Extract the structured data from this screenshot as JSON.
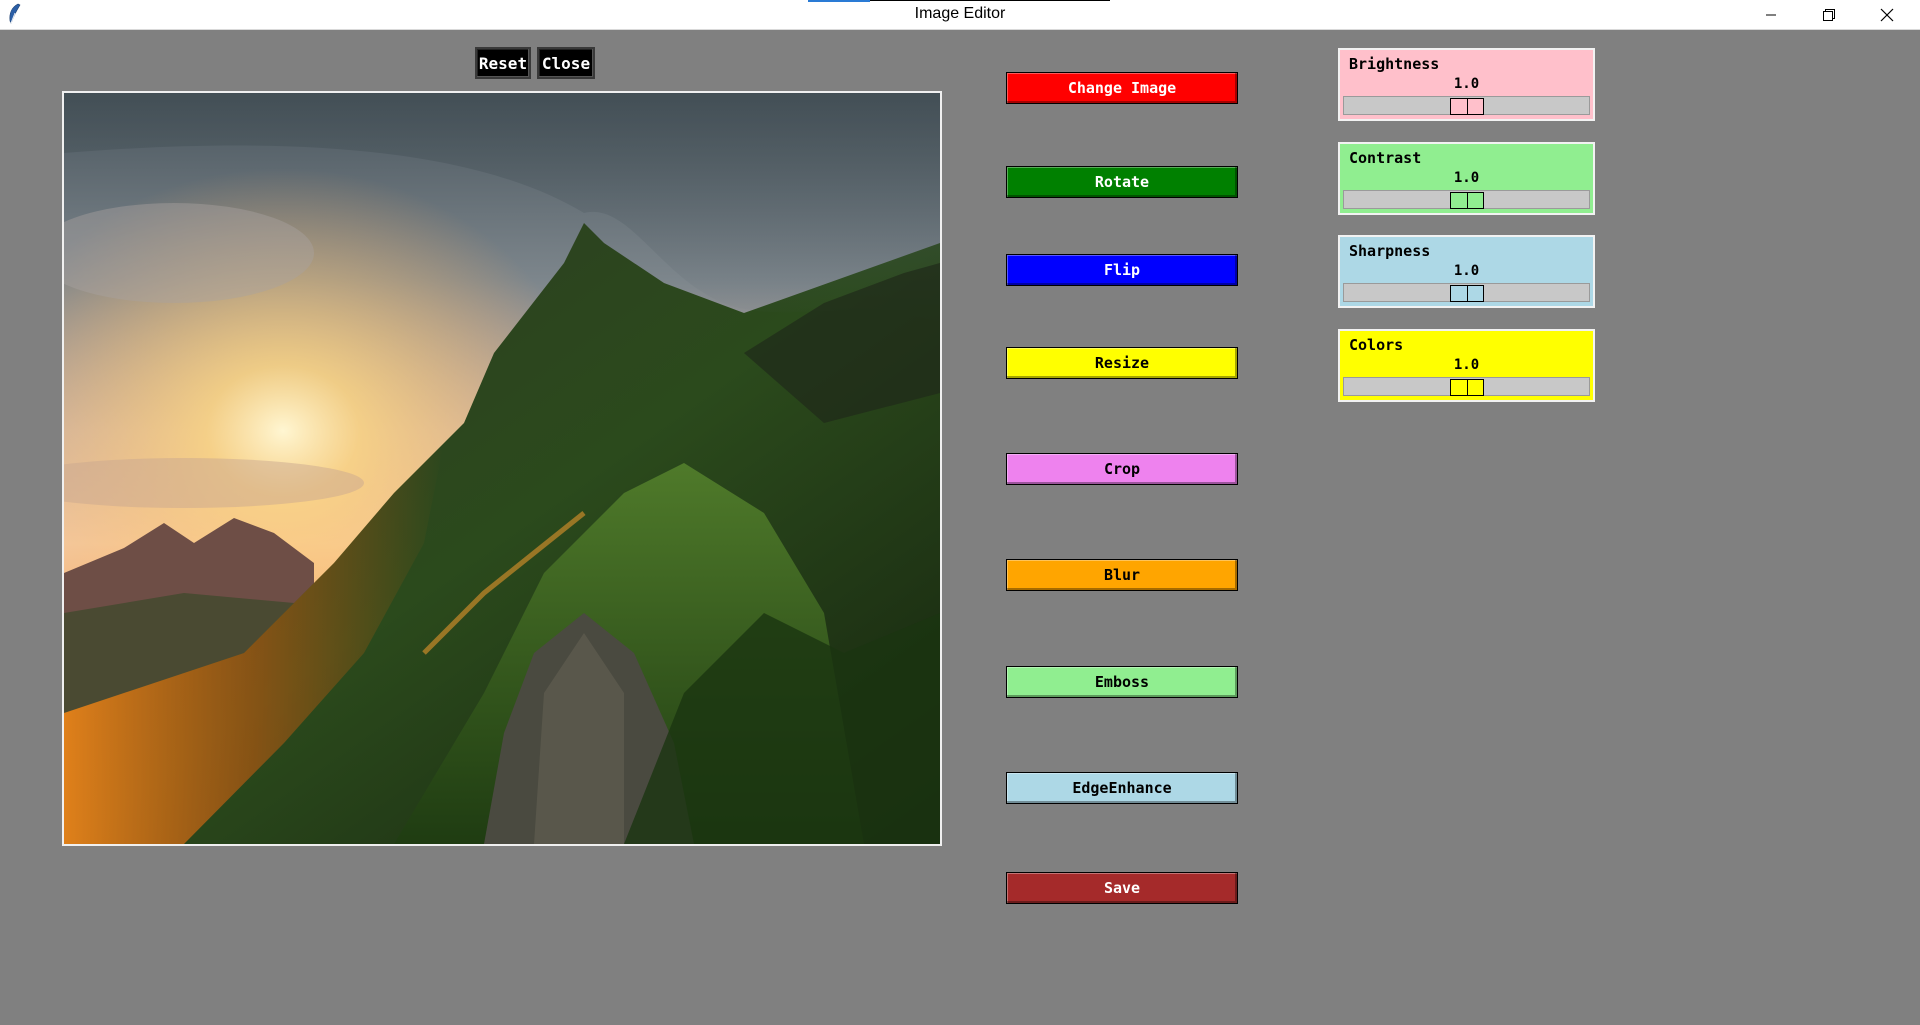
{
  "window": {
    "title": "Image Editor",
    "controls": [
      "minimize-icon",
      "restore-icon",
      "close-icon"
    ]
  },
  "top_buttons": {
    "reset": "Reset",
    "close": "Close"
  },
  "tools": [
    {
      "label": "Change Image",
      "bg": "#ff0000",
      "fg": "#ffffff"
    },
    {
      "label": "Rotate",
      "bg": "#008000",
      "fg": "#ffffff"
    },
    {
      "label": "Flip",
      "bg": "#0000ff",
      "fg": "#ffffff"
    },
    {
      "label": "Resize",
      "bg": "#ffff00",
      "fg": "#000000"
    },
    {
      "label": "Crop",
      "bg": "#ee82ee",
      "fg": "#000000"
    },
    {
      "label": "Blur",
      "bg": "#ffa500",
      "fg": "#000000"
    },
    {
      "label": "Emboss",
      "bg": "#90ee90",
      "fg": "#000000"
    },
    {
      "label": "EdgeEnhance",
      "bg": "#add8e6",
      "fg": "#000000"
    },
    {
      "label": "Save",
      "bg": "#a52a2a",
      "fg": "#ffffff"
    }
  ],
  "adjustments": [
    {
      "label": "Brightness",
      "value": "1.0",
      "level": 0.5,
      "bg": "#ffc0cb"
    },
    {
      "label": "Contrast",
      "value": "1.0",
      "level": 0.5,
      "bg": "#90ee90"
    },
    {
      "label": "Sharpness",
      "value": "1.0",
      "level": 0.5,
      "bg": "#add8e6"
    },
    {
      "label": "Colors",
      "value": "1.0",
      "level": 0.5,
      "bg": "#ffff00"
    }
  ]
}
